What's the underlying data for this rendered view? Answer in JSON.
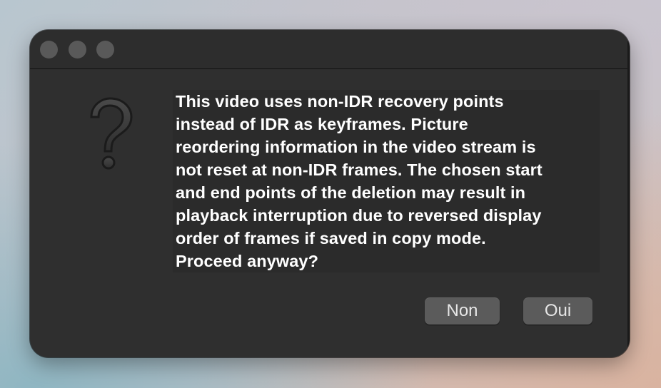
{
  "window": {
    "traffic_lights": [
      "close",
      "minimize",
      "zoom"
    ]
  },
  "dialog": {
    "icon": "question-mark-icon",
    "message": "This video uses non-IDR recovery points\ninstead of IDR as keyframes. Picture\nreordering information in the video stream is\nnot reset at non-IDR frames. The chosen start\nand end points of the deletion may result in\nplayback interruption due to reversed display\norder of frames if saved in copy mode.\nProceed anyway?",
    "buttons": {
      "no_label": "Non",
      "yes_label": "Oui"
    }
  },
  "colors": {
    "window_bg": "#2f2f2f",
    "button_bg": "#5b5b5b",
    "text": "#ffffff"
  }
}
